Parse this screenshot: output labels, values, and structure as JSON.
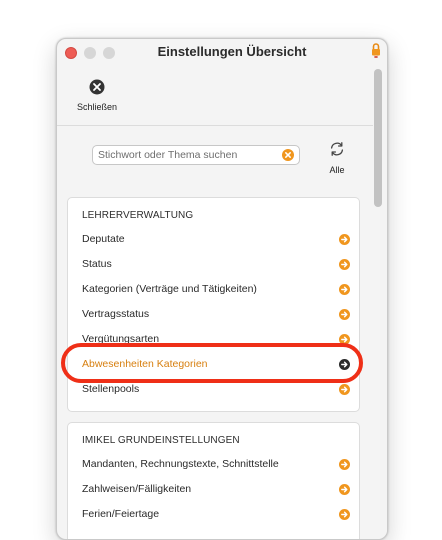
{
  "window": {
    "title": "Einstellungen Übersicht"
  },
  "toolbar": {
    "close_label": "Schließen"
  },
  "search": {
    "placeholder": "Stichwort oder Thema suchen",
    "value": ""
  },
  "all_button": {
    "label": "Alle"
  },
  "colors": {
    "accent": "#f0961e",
    "highlight_text": "#d77f0f",
    "annotation_ring": "#ef2f17",
    "close_red": "#ee5c55"
  },
  "icons": {
    "close": "close-circle-icon",
    "search_clear": "clear-search-icon",
    "all": "refresh-icon",
    "row_arrow": "arrow-right-circle-icon",
    "lock": "lock-icon"
  },
  "sections": [
    {
      "title": "LEHRERVERWALTUNG",
      "items": [
        "Deputate",
        "Status",
        "Kategorien (Verträge und Tätigkeiten)",
        "Vertragsstatus",
        "Vergütungsarten",
        "Abwesenheiten Kategorien",
        "Stellenpools"
      ]
    },
    {
      "title": "IMIKEL GRUNDEINSTELLUNGEN",
      "items": [
        "Mandanten, Rechnungstexte, Schnittstelle",
        "Zahlweisen/Fälligkeiten",
        "Ferien/Feiertage"
      ]
    }
  ]
}
